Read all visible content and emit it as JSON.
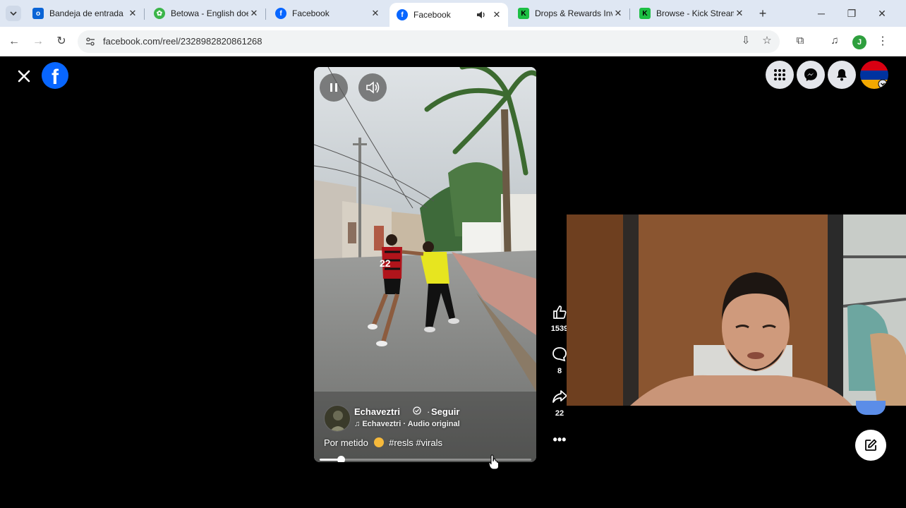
{
  "browser": {
    "tabs": [
      {
        "title": "Bandeja de entrada",
        "favicon": "outlook-icon",
        "color": "#0a64d6"
      },
      {
        "title": "Betowa - English doe",
        "favicon": "betowa-icon",
        "color": "#3bb54a"
      },
      {
        "title": "Facebook",
        "favicon": "facebook-icon",
        "color": "#0866ff"
      },
      {
        "title": "Facebook",
        "favicon": "facebook-icon",
        "color": "#0866ff",
        "active": true,
        "audio": true
      },
      {
        "title": "Drops & Rewards Inv",
        "favicon": "kick-icon",
        "color": "#1dbf44"
      },
      {
        "title": "Browse - Kick Stream",
        "favicon": "kick-icon",
        "color": "#1dbf44"
      }
    ],
    "url": "facebook.com/reel/2328982820861268",
    "profile_initial": "J"
  },
  "reel": {
    "author": "Echaveztri",
    "follow_label": "Seguir",
    "audio": "Echaveztri · Audio original",
    "caption_prefix": "Por metido",
    "caption_tags": "#resls #virals",
    "progress": 0.1,
    "jersey_number": "22"
  },
  "actions": {
    "likes": "1539",
    "comments": "8",
    "shares": "22"
  },
  "colors": {
    "facebook_blue": "#0866ff",
    "tabstrip_bg": "#dfe7f3"
  }
}
